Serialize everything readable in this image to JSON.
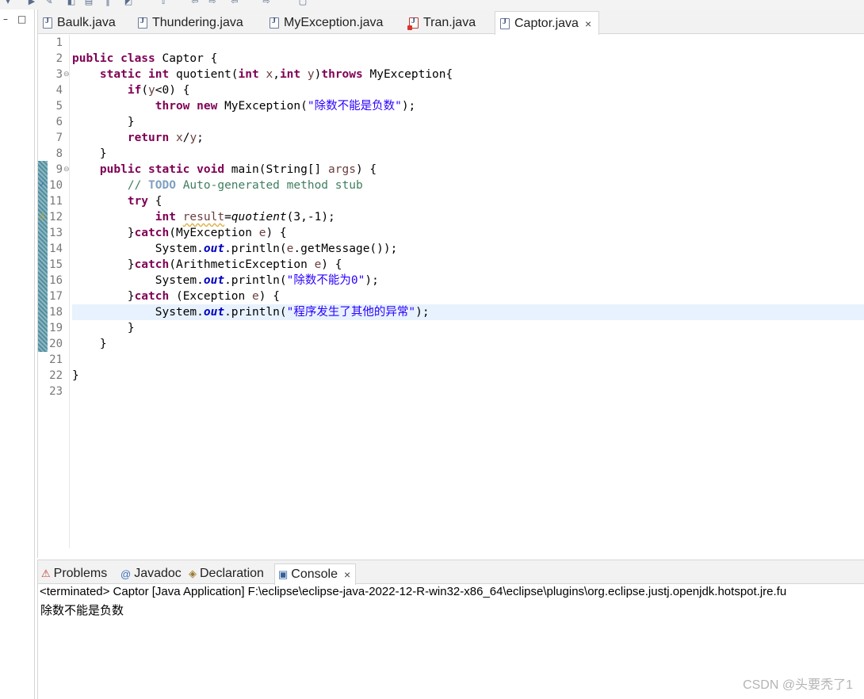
{
  "editor": {
    "tabs": [
      {
        "label": "Baulk.java",
        "icon": "java-file-icon",
        "active": false
      },
      {
        "label": "Thundering.java",
        "icon": "java-file-icon",
        "active": false
      },
      {
        "label": "MyException.java",
        "icon": "java-file-icon",
        "active": false
      },
      {
        "label": "Tran.java",
        "icon": "java-file-error-icon",
        "active": false
      },
      {
        "label": "Captor.java",
        "icon": "java-file-icon",
        "active": true,
        "close": "×"
      }
    ],
    "line_numbers": [
      "1",
      "2",
      "3",
      "4",
      "5",
      "6",
      "7",
      "8",
      "9",
      "10",
      "11",
      "12",
      "13",
      "14",
      "15",
      "16",
      "17",
      "18",
      "19",
      "20",
      "21",
      "22",
      "23"
    ],
    "current_line": 18,
    "code": [
      [],
      [
        {
          "t": "public class",
          "c": "kw"
        },
        {
          "t": " Captor {"
        }
      ],
      [
        {
          "t": "    "
        },
        {
          "t": "static int",
          "c": "kw"
        },
        {
          "t": " quotient("
        },
        {
          "t": "int",
          "c": "kw"
        },
        {
          "t": " "
        },
        {
          "t": "x",
          "c": "var"
        },
        {
          "t": ","
        },
        {
          "t": "int",
          "c": "kw"
        },
        {
          "t": " "
        },
        {
          "t": "y",
          "c": "var"
        },
        {
          "t": ")"
        },
        {
          "t": "throws",
          "c": "kw"
        },
        {
          "t": " MyException{"
        }
      ],
      [
        {
          "t": "        "
        },
        {
          "t": "if",
          "c": "kw"
        },
        {
          "t": "("
        },
        {
          "t": "y",
          "c": "var"
        },
        {
          "t": "<0) {"
        }
      ],
      [
        {
          "t": "            "
        },
        {
          "t": "throw new",
          "c": "kw"
        },
        {
          "t": " MyException("
        },
        {
          "t": "\"除数不能是负数\"",
          "c": "str"
        },
        {
          "t": ");"
        }
      ],
      [
        {
          "t": "        }"
        }
      ],
      [
        {
          "t": "        "
        },
        {
          "t": "return",
          "c": "kw"
        },
        {
          "t": " "
        },
        {
          "t": "x",
          "c": "var"
        },
        {
          "t": "/"
        },
        {
          "t": "y",
          "c": "var"
        },
        {
          "t": ";"
        }
      ],
      [
        {
          "t": "    }"
        }
      ],
      [
        {
          "t": "    "
        },
        {
          "t": "public static void",
          "c": "kw"
        },
        {
          "t": " main(String[] "
        },
        {
          "t": "args",
          "c": "var"
        },
        {
          "t": ") {"
        }
      ],
      [
        {
          "t": "        "
        },
        {
          "t": "// ",
          "c": "cmt"
        },
        {
          "t": "TODO",
          "c": "todo"
        },
        {
          "t": " Auto-generated method stub",
          "c": "cmt"
        }
      ],
      [
        {
          "t": "        "
        },
        {
          "t": "try",
          "c": "kw"
        },
        {
          "t": " {"
        }
      ],
      [
        {
          "t": "            "
        },
        {
          "t": "int",
          "c": "kw"
        },
        {
          "t": " "
        },
        {
          "t": "result",
          "c": "var warn-ul"
        },
        {
          "t": "="
        },
        {
          "t": "quotient",
          "c": "ital"
        },
        {
          "t": "(3,-1);"
        }
      ],
      [
        {
          "t": "        }"
        },
        {
          "t": "catch",
          "c": "kw"
        },
        {
          "t": "(MyException "
        },
        {
          "t": "e",
          "c": "var"
        },
        {
          "t": ") {"
        }
      ],
      [
        {
          "t": "            System."
        },
        {
          "t": "out",
          "c": "fld"
        },
        {
          "t": ".println("
        },
        {
          "t": "e",
          "c": "var"
        },
        {
          "t": ".getMessage());"
        }
      ],
      [
        {
          "t": "        }"
        },
        {
          "t": "catch",
          "c": "kw"
        },
        {
          "t": "(ArithmeticException "
        },
        {
          "t": "e",
          "c": "var"
        },
        {
          "t": ") {"
        }
      ],
      [
        {
          "t": "            System."
        },
        {
          "t": "out",
          "c": "fld"
        },
        {
          "t": ".println("
        },
        {
          "t": "\"除数不能为0\"",
          "c": "str"
        },
        {
          "t": ");"
        }
      ],
      [
        {
          "t": "        }"
        },
        {
          "t": "catch",
          "c": "kw"
        },
        {
          "t": " (Exception "
        },
        {
          "t": "e",
          "c": "var"
        },
        {
          "t": ") {"
        }
      ],
      [
        {
          "t": "            System."
        },
        {
          "t": "out",
          "c": "fld"
        },
        {
          "t": ".println("
        },
        {
          "t": "\"程序发生了其他的异常\"",
          "c": "str"
        },
        {
          "t": ");"
        }
      ],
      [
        {
          "t": "        }"
        }
      ],
      [
        {
          "t": "    }"
        }
      ],
      [],
      [
        {
          "t": "}"
        }
      ],
      []
    ],
    "fold_lines": [
      3,
      9
    ],
    "scroll_left": "<",
    "scroll_right": ">"
  },
  "console": {
    "tabs": [
      {
        "label": "Problems",
        "icon": "problems-icon",
        "glyph": "⚠"
      },
      {
        "label": "Javadoc",
        "icon": "javadoc-icon",
        "glyph": "@"
      },
      {
        "label": "Declaration",
        "icon": "declaration-icon",
        "glyph": "◈"
      },
      {
        "label": "Console",
        "icon": "console-icon",
        "glyph": "▣",
        "active": true,
        "close": "×"
      }
    ],
    "status": "<terminated> Captor [Java Application] F:\\eclipse\\eclipse-java-2022-12-R-win32-x86_64\\eclipse\\plugins\\org.eclipse.justj.openjdk.hotspot.jre.fu",
    "output": "除数不能是负数"
  },
  "left_pane": {
    "minimize": "–",
    "maximize": "□"
  },
  "watermark": "CSDN @头要秃了1",
  "colors": {
    "keyword": "#7f0055",
    "string": "#2a00ff",
    "comment": "#3f7f5f",
    "current_line": "#e8f2fe"
  }
}
